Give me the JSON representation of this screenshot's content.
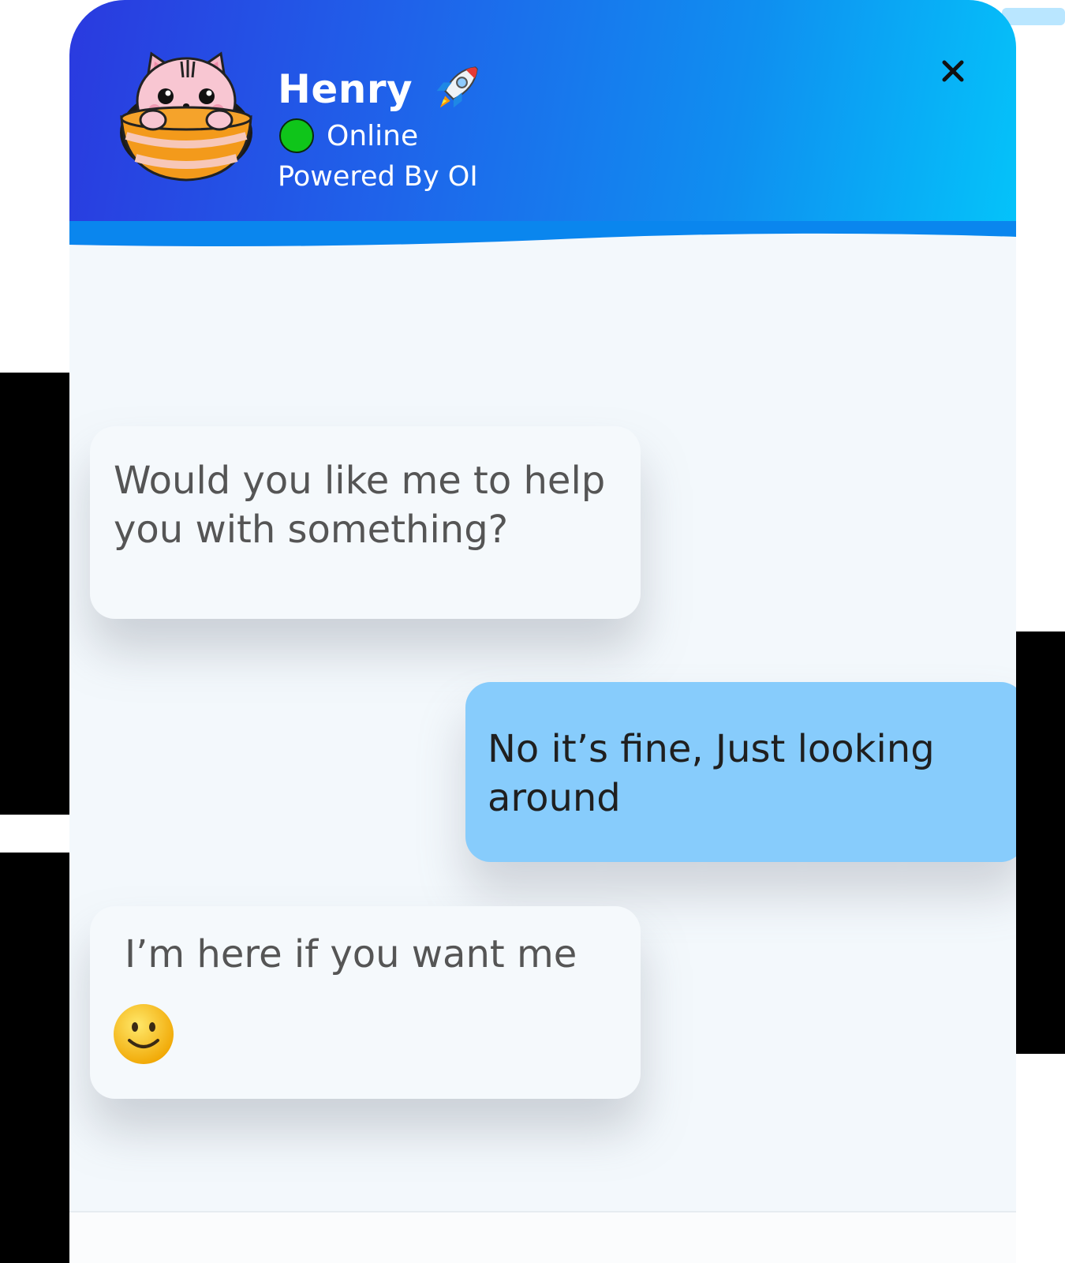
{
  "header": {
    "bot_name": "Henry",
    "status": "Online",
    "powered_by": "Powered By OI",
    "status_color": "#0fc51a",
    "gradient": [
      "#2a3adf",
      "#04c4fa"
    ]
  },
  "icons": {
    "avatar": "cat-in-bowl-avatar",
    "rocket": "rocket-icon",
    "close": "close-icon",
    "emoji": "smiley-emoji"
  },
  "messages": [
    {
      "sender": "bot",
      "text": "Would you like me to help you with something?"
    },
    {
      "sender": "user",
      "text": "No it’s fine, Just looking around"
    },
    {
      "sender": "bot",
      "text": "I’m here if you want me"
    }
  ],
  "colors": {
    "bot_bubble": "#f5f9fc",
    "user_bubble": "#87ccfc",
    "chat_background": "#f3f8fc"
  }
}
